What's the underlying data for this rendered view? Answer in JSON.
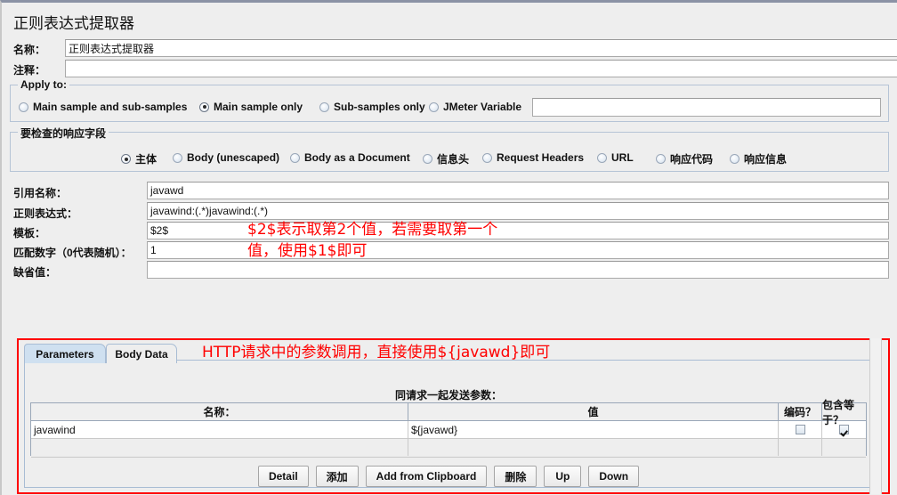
{
  "window": {
    "title": "正则表达式提取器"
  },
  "fields": {
    "name_label": "名称：",
    "name_value": "正则表达式提取器",
    "comment_label": "注释：",
    "comment_value": ""
  },
  "apply_to": {
    "title": "Apply to:",
    "options": [
      {
        "label": "Main sample and sub-samples",
        "selected": false
      },
      {
        "label": "Main sample only",
        "selected": true
      },
      {
        "label": "Sub-samples only",
        "selected": false
      },
      {
        "label": "JMeter Variable",
        "selected": false
      }
    ],
    "variable_value": ""
  },
  "response_field": {
    "title": "要检查的响应字段",
    "options": [
      {
        "label": "主体",
        "selected": true
      },
      {
        "label": "Body (unescaped)",
        "selected": false
      },
      {
        "label": "Body as a Document",
        "selected": false
      },
      {
        "label": "信息头",
        "selected": false
      },
      {
        "label": "Request Headers",
        "selected": false
      },
      {
        "label": "URL",
        "selected": false
      },
      {
        "label": "响应代码",
        "selected": false
      },
      {
        "label": "响应信息",
        "selected": false
      }
    ]
  },
  "extractor": {
    "rows": [
      {
        "label": "引用名称：",
        "value": "javawd"
      },
      {
        "label": "正则表达式：",
        "value": "javawind:(.*)javawind:(.*)"
      },
      {
        "label": "模板：",
        "value": "$2$"
      },
      {
        "label": "匹配数字（0代表随机）：",
        "value": "1"
      },
      {
        "label": "缺省值：",
        "value": ""
      }
    ]
  },
  "annotations": {
    "template_note_line1": "$2$表示取第2个值，若需要取第一个",
    "template_note_line2": "值，使用$1$即可",
    "http_note": "HTTP请求中的参数调用，直接使用${javawd}即可",
    "color": "#ff0000"
  },
  "bottom_panel": {
    "tabs": [
      {
        "label": "Parameters",
        "active": true
      },
      {
        "label": "Body Data",
        "active": false
      }
    ],
    "caption": "同请求一起发送参数：",
    "table": {
      "headers": [
        "名称：",
        "值",
        "编码？",
        "包含等于？"
      ],
      "rows": [
        {
          "name": "javawind",
          "value": "${javawd}",
          "encode": false,
          "include_equals": true
        }
      ]
    },
    "buttons": [
      "Detail",
      "添加",
      "Add from Clipboard",
      "删除",
      "Up",
      "Down"
    ]
  }
}
